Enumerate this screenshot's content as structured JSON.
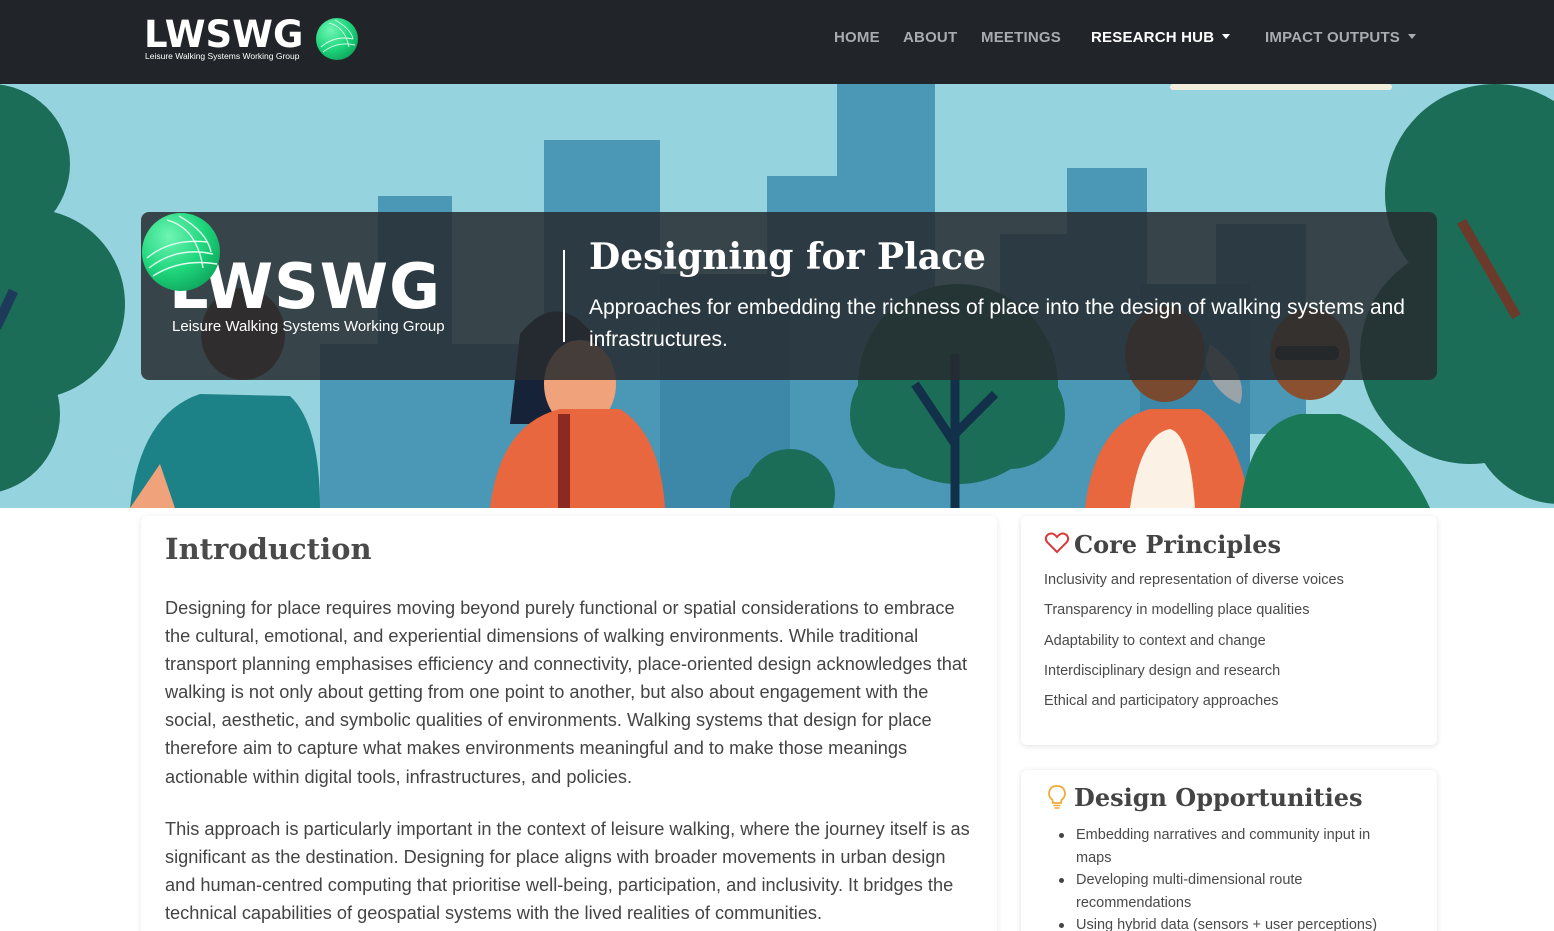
{
  "brand": {
    "name": "LWSWG",
    "tagline": "Leisure Walking Systems Working Group"
  },
  "nav": {
    "items": [
      {
        "label": "HOME",
        "active": false,
        "dropdown": false
      },
      {
        "label": "ABOUT",
        "active": false,
        "dropdown": false
      },
      {
        "label": "MEETINGS",
        "active": false,
        "dropdown": false
      },
      {
        "label": "RESEARCH HUB",
        "active": true,
        "dropdown": true
      },
      {
        "label": "IMPACT OUTPUTS",
        "active": false,
        "dropdown": true
      }
    ]
  },
  "hero": {
    "title": "Designing for Place",
    "description": "Approaches for embedding the richness of place into the design of walking systems and infrastructures."
  },
  "main": {
    "title": "Introduction",
    "paragraphs": [
      "Designing for place requires moving beyond purely functional or spatial considerations to embrace the cultural, emotional, and experiential dimensions of walking environments. While traditional transport planning emphasises efficiency and connectivity, place-oriented design acknowledges that walking is not only about getting from one point to another, but also about engagement with the social, aesthetic, and symbolic qualities of environments. Walking systems that design for place therefore aim to capture what makes environments meaningful and to make those meanings actionable within digital tools, infrastructures, and policies.",
      "This approach is particularly important in the context of leisure walking, where the journey itself is as significant as the destination. Designing for place aligns with broader movements in urban design and human-centred computing that prioritise well-being, participation, and inclusivity. It bridges the technical capabilities of geospatial systems with the lived realities of communities."
    ]
  },
  "principles": {
    "title": "Core Principles",
    "icon": "heart-icon",
    "items": [
      "Inclusivity and representation of diverse voices",
      "Transparency in modelling place qualities",
      "Adaptability to context and change",
      "Interdisciplinary design and research",
      "Ethical and participatory approaches"
    ]
  },
  "opportunities": {
    "title": "Design Opportunities",
    "icon": "lightbulb-icon",
    "items": [
      "Embedding narratives and community input in maps",
      "Developing multi-dimensional route recommendations",
      "Using hybrid data (sensors + user perceptions)"
    ]
  },
  "colors": {
    "navbar": "#212529",
    "accent_green": "#2ee08a",
    "heart": "#d63a3a",
    "bulb": "#f0a93a",
    "sky": "#95d3de"
  }
}
